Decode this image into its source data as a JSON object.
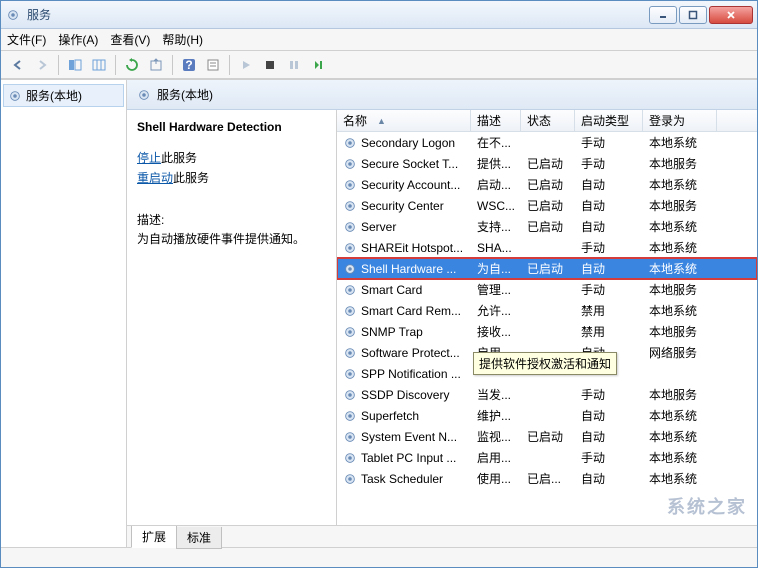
{
  "window": {
    "title": "服务"
  },
  "menus": {
    "file": "文件(F)",
    "action": "操作(A)",
    "view": "查看(V)",
    "help": "帮助(H)"
  },
  "tree": {
    "root": "服务(本地)"
  },
  "header": {
    "title": "服务(本地)"
  },
  "detail": {
    "name": "Shell Hardware Detection",
    "stop_prefix": "停止",
    "restart_prefix": "重启动",
    "link_suffix": "此服务",
    "desc_label": "描述:",
    "desc_text": "为自动播放硬件事件提供通知。"
  },
  "columns": {
    "name": "名称",
    "desc": "描述",
    "status": "状态",
    "startup": "启动类型",
    "logon": "登录为"
  },
  "tabs": {
    "extended": "扩展",
    "standard": "标准"
  },
  "tooltip": "提供软件授权激活和通知",
  "services": [
    {
      "name": "Secondary Logon",
      "desc": "在不...",
      "status": "",
      "startup": "手动",
      "logon": "本地系统"
    },
    {
      "name": "Secure Socket T...",
      "desc": "提供...",
      "status": "已启动",
      "startup": "手动",
      "logon": "本地服务"
    },
    {
      "name": "Security Account...",
      "desc": "启动...",
      "status": "已启动",
      "startup": "自动",
      "logon": "本地系统"
    },
    {
      "name": "Security Center",
      "desc": "WSC...",
      "status": "已启动",
      "startup": "自动",
      "logon": "本地服务"
    },
    {
      "name": "Server",
      "desc": "支持...",
      "status": "已启动",
      "startup": "自动",
      "logon": "本地系统"
    },
    {
      "name": "SHAREit Hotspot...",
      "desc": "SHA...",
      "status": "",
      "startup": "手动",
      "logon": "本地系统"
    },
    {
      "name": "Shell Hardware ...",
      "desc": "为自...",
      "status": "已启动",
      "startup": "自动",
      "logon": "本地系统",
      "selected": true
    },
    {
      "name": "Smart Card",
      "desc": "管理...",
      "status": "",
      "startup": "手动",
      "logon": "本地服务"
    },
    {
      "name": "Smart Card Rem...",
      "desc": "允许...",
      "status": "",
      "startup": "禁用",
      "logon": "本地系统"
    },
    {
      "name": "SNMP Trap",
      "desc": "接收...",
      "status": "",
      "startup": "禁用",
      "logon": "本地服务"
    },
    {
      "name": "Software Protect...",
      "desc": "启用...",
      "status": "",
      "startup": "自动",
      "logon": "网络服务"
    },
    {
      "name": "SPP Notification ...",
      "desc": "",
      "status": "",
      "startup": "",
      "logon": ""
    },
    {
      "name": "SSDP Discovery",
      "desc": "当发...",
      "status": "",
      "startup": "手动",
      "logon": "本地服务"
    },
    {
      "name": "Superfetch",
      "desc": "维护...",
      "status": "",
      "startup": "自动",
      "logon": "本地系统"
    },
    {
      "name": "System Event N...",
      "desc": "监视...",
      "status": "已启动",
      "startup": "自动",
      "logon": "本地系统"
    },
    {
      "name": "Tablet PC Input ...",
      "desc": "启用...",
      "status": "",
      "startup": "手动",
      "logon": "本地系统"
    },
    {
      "name": "Task Scheduler",
      "desc": "使用...",
      "status": "已启...",
      "startup": "自动",
      "logon": "本地系统"
    }
  ]
}
